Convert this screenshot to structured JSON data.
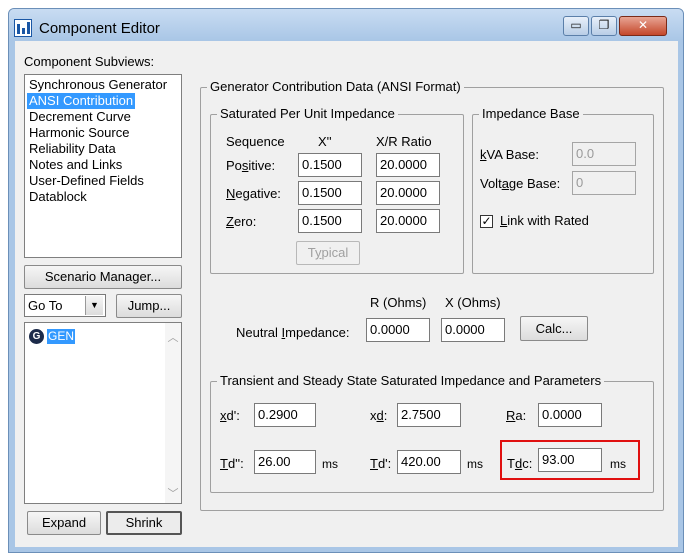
{
  "window": {
    "title": "Component Editor",
    "min_glyph": "▭",
    "max_glyph": "❐",
    "close_glyph": "✕"
  },
  "subviews": {
    "label": "Component Subviews:",
    "items": [
      "Synchronous Generator",
      "ANSI Contribution",
      "Decrement Curve",
      "Harmonic Source",
      "Reliability Data",
      "Notes and Links",
      "User-Defined Fields",
      "Datablock"
    ],
    "selected_index": 1
  },
  "left_controls": {
    "scenario_manager": "Scenario Manager...",
    "goto_value": "Go To",
    "dropdown_glyph": "▼",
    "jump": "Jump...",
    "tree_icon_letter": "G",
    "tree_item": "GEN",
    "expand": "Expand",
    "shrink": "Shrink",
    "scroll_up": "︿",
    "scroll_down": "﹀"
  },
  "main": {
    "group_title": "Generator Contribution Data (ANSI Format)",
    "sat": {
      "title": "Saturated Per Unit Impedance",
      "col_sequence": "Sequence",
      "col_x": "X''",
      "col_xr": "X/R Ratio",
      "rows": [
        {
          "pre": "Po",
          "ul": "s",
          "post": "itive:",
          "x": "0.1500",
          "xr": "20.0000"
        },
        {
          "pre": "",
          "ul": "N",
          "post": "egative:",
          "x": "0.1500",
          "xr": "20.0000"
        },
        {
          "pre": "",
          "ul": "Z",
          "post": "ero:",
          "x": "0.1500",
          "xr": "20.0000"
        }
      ],
      "typical_pre": "T",
      "typical_ul": "y",
      "typical_post": "pical"
    },
    "base": {
      "title": "Impedance Base",
      "kva_ul": "k",
      "kva_post": "VA Base:",
      "kva_value": "0.0",
      "volt_pre": "Volt",
      "volt_ul": "a",
      "volt_post": "ge Base:",
      "volt_value": "0",
      "link_ul": "L",
      "link_post": "ink with Rated",
      "link_checked": true,
      "check_glyph": "✓"
    },
    "neutral": {
      "r_label": "R (Ohms)",
      "x_label": "X (Ohms)",
      "label_pre": "Neutral ",
      "label_ul": "I",
      "label_post": "mpedance:",
      "r_value": "0.0000",
      "x_value": "0.0000",
      "calc": "Calc..."
    },
    "transient": {
      "title": "Transient and Steady State Saturated Impedance and Parameters",
      "xd1_ul": "x",
      "xd1_post": "d':",
      "xd1_value": "0.2900",
      "xd_pre": "x",
      "xd_ul": "d",
      "xd_post": ":",
      "xd_value": "2.7500",
      "ra_ul": "R",
      "ra_post": "a:",
      "ra_value": "0.0000",
      "td2_ul": "T",
      "td2_post": "d'':",
      "td2_value": "26.00",
      "td1_ul": "T",
      "td1_post": "d':",
      "td1_value": "420.00",
      "tdc_pre": "T",
      "tdc_ul": "d",
      "tdc_post": "c:",
      "tdc_value": "93.00",
      "unit": "ms"
    }
  }
}
